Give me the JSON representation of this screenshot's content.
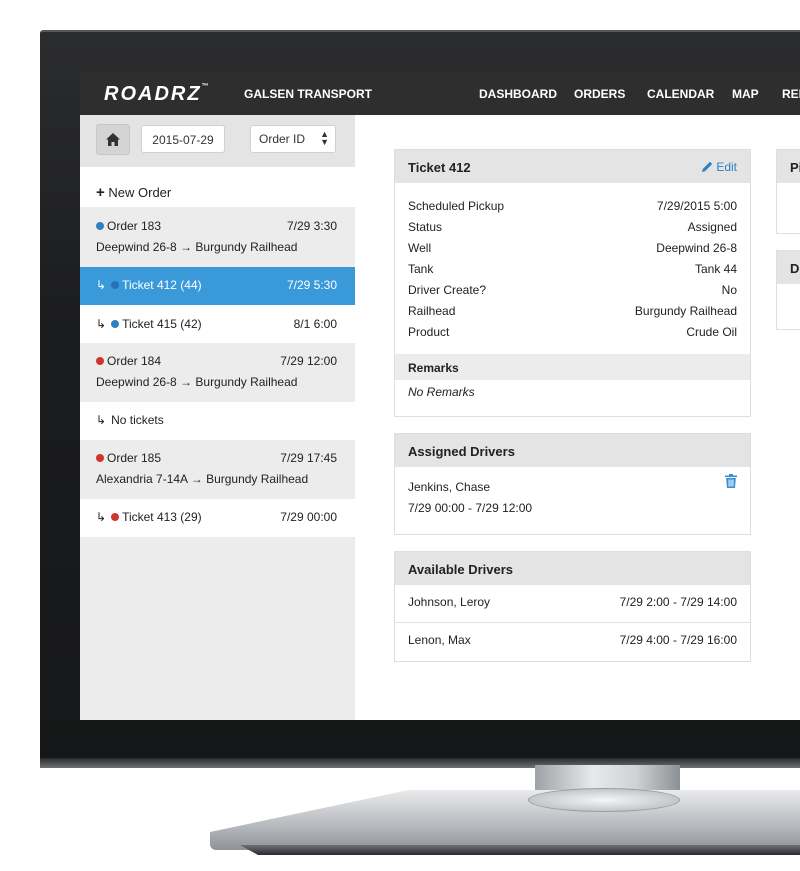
{
  "app": {
    "logo": "ROADRZ",
    "logo_tm": "™",
    "company": "GALSEN TRANSPORT",
    "nav": [
      "DASHBOARD",
      "ORDERS",
      "CALENDAR",
      "MAP",
      "REPORTS"
    ]
  },
  "sidebar": {
    "date_value": "2015-07-29",
    "sort_select": "Order ID",
    "new_order_label": "New Order",
    "rows": [
      {
        "type": "order",
        "title": "Order 183",
        "time": "7/29 3:30",
        "route": "Deepwind 26-8 → Burgundy Railhead",
        "status_color": "blue"
      },
      {
        "type": "ticket",
        "title": "Ticket 412 (44)",
        "time": "7/29 5:30",
        "active": true
      },
      {
        "type": "ticket",
        "title": "Ticket 415 (42)",
        "time": "8/1 6:00"
      },
      {
        "type": "order",
        "title": "Order 184",
        "time": "7/29 12:00",
        "route": "Deepwind 26-8 → Burgundy Railhead",
        "status_color": "red"
      },
      {
        "type": "empty",
        "title": "No tickets"
      },
      {
        "type": "order",
        "title": "Order 185",
        "time": "7/29 17:45",
        "route": "Alexandria 7-14A → Burgundy Railhead",
        "status_color": "red"
      },
      {
        "type": "ticket",
        "title": "Ticket 413 (29)",
        "time": "7/29 00:00"
      }
    ]
  },
  "ticket": {
    "title": "Ticket 412",
    "edit_label": "Edit",
    "fields": [
      {
        "label": "Scheduled Pickup",
        "value": "7/29/2015 5:00"
      },
      {
        "label": "Status",
        "value": "Assigned"
      },
      {
        "label": "Well",
        "value": "Deepwind 26-8"
      },
      {
        "label": "Tank",
        "value": "Tank 44"
      },
      {
        "label": "Driver Create?",
        "value": "No"
      },
      {
        "label": "Railhead",
        "value": "Burgundy Railhead"
      },
      {
        "label": "Product",
        "value": "Crude Oil"
      }
    ],
    "remarks_heading": "Remarks",
    "remarks_text": "No Remarks"
  },
  "assigned": {
    "title": "Assigned Drivers",
    "driver_name": "Jenkins, Chase",
    "driver_window": "7/29 00:00 - 7/29 12:00"
  },
  "available": {
    "title": "Available Drivers",
    "drivers": [
      {
        "name": "Johnson, Leroy",
        "window": "7/29 2:00 - 7/29 14:00"
      },
      {
        "name": "Lenon, Max",
        "window": "7/29 4:00 - 7/29 16:00"
      }
    ]
  },
  "right_panels": {
    "first_title": "Pi",
    "second_title": "D"
  },
  "colors": {
    "navbar": "#2e2e2e",
    "active_row": "#3a9ad9",
    "status_blue": "#2f7fc1",
    "status_red": "#d0342c"
  },
  "icons": {
    "home": "home-icon",
    "edit": "pencil-icon",
    "delete": "trash-icon",
    "add": "plus-icon",
    "sort": "sort-arrows-icon"
  }
}
